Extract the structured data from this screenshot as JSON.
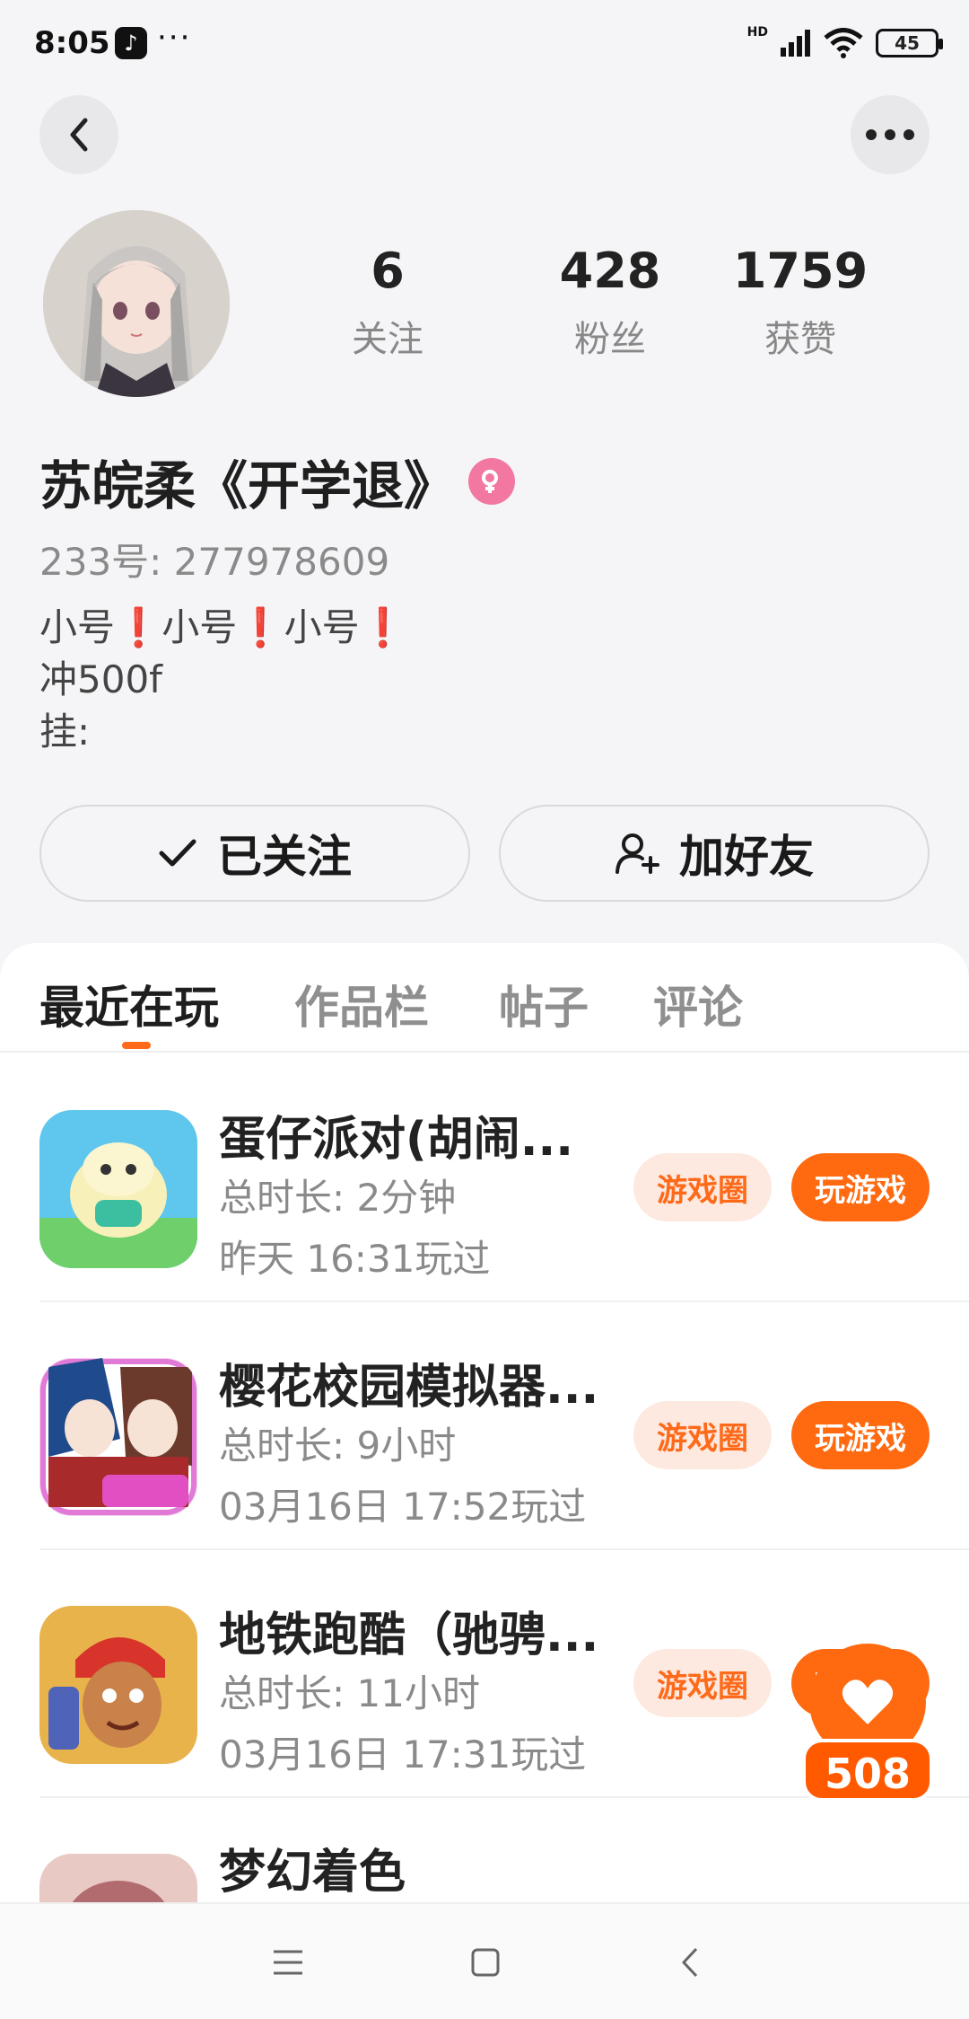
{
  "status_bar": {
    "time": "8:05",
    "app_badge": "♪",
    "dots": "···",
    "network": "HD",
    "battery": "45"
  },
  "profile": {
    "stats": [
      {
        "value": "6",
        "label": "关注"
      },
      {
        "value": "428",
        "label": "粉丝"
      },
      {
        "value": "1759",
        "label": "获赞"
      }
    ],
    "username": "苏皖柔《开学退》",
    "user_id": "233号: 277978609",
    "bio": "小号❗小号❗小号❗\n冲500f\n挂:",
    "follow_label": "已关注",
    "add_friend_label": "加好友"
  },
  "tabs": [
    {
      "label": "最近在玩",
      "active": true
    },
    {
      "label": "作品栏",
      "active": false
    },
    {
      "label": "帖子",
      "active": false
    },
    {
      "label": "评论",
      "active": false
    }
  ],
  "games": [
    {
      "title": "蛋仔派对(胡闹...",
      "duration": "总时长: 2分钟",
      "last_played": "昨天 16:31玩过",
      "circle_label": "游戏圈",
      "play_label": "玩游戏"
    },
    {
      "title": "樱花校园模拟器...",
      "duration": "总时长: 9小时",
      "last_played": "03月16日 17:52玩过",
      "circle_label": "游戏圈",
      "play_label": "玩游戏"
    },
    {
      "title": "地铁跑酷（驰骋...",
      "duration": "总时长: 11小时",
      "last_played": "03月16日 17:31玩过",
      "circle_label": "游戏圈",
      "play_label": "玩游戏"
    },
    {
      "title": "梦幻着色",
      "duration": "",
      "last_played": "",
      "circle_label": "",
      "play_label": ""
    }
  ],
  "floating_like": {
    "count": "508"
  },
  "colors": {
    "accent": "#ff6a10",
    "pill_bg": "#fde9df",
    "gender": "#f278a1"
  }
}
